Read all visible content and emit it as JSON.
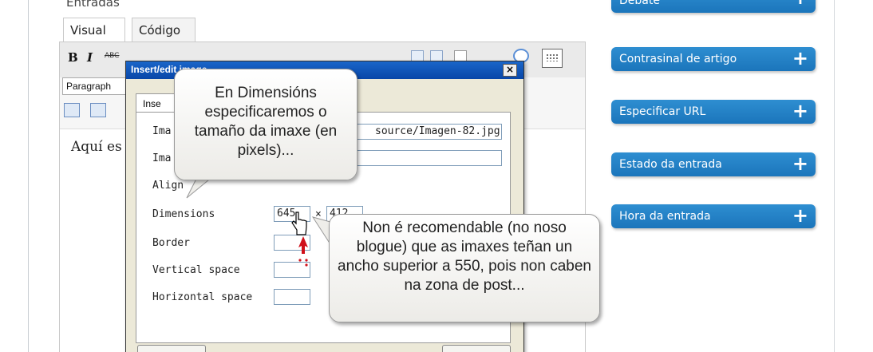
{
  "editor": {
    "section_title": "Entradas",
    "tabs": [
      {
        "label": "Visual"
      },
      {
        "label": "Código"
      }
    ],
    "toolbar": {
      "bold": "B",
      "italic": "I",
      "strike": "ABC",
      "paragraph": "Paragraph"
    },
    "content_text": "Aquí es"
  },
  "dialog": {
    "title": "Insert/edit image",
    "close": "×",
    "tab": "Inse",
    "fields": {
      "image_url_label": "Ima",
      "image_url_value": "source/Imagen-82.jpg",
      "image_desc_label": "Ima",
      "alignment_label": "Align",
      "dimensions_label": "Dimensions",
      "width": "645",
      "times": "×",
      "height": "412",
      "border_label": "Border",
      "vspace_label": "Vertical space",
      "hspace_label": "Horizontal space"
    }
  },
  "callouts": {
    "dimensions_note": "En Dimensións especificaremos o tamaño da imaxe (en pixels)...",
    "width_warning": "Non é recomendable (no noso blogue) que as imaxes teñan un ancho superior a 550, pois non caben na zona de post..."
  },
  "sidebar": {
    "items": [
      {
        "label": "Debate"
      },
      {
        "label": "Contrasinal de artigo"
      },
      {
        "label": "Especificar URL"
      },
      {
        "label": "Estado da entrada"
      },
      {
        "label": "Hora da entrada"
      }
    ],
    "plus_icon": "+"
  },
  "colors": {
    "sidebar_button": "#1b75bb",
    "dialog_title": "#0846a8",
    "warning_arrow": "#d0101a"
  }
}
